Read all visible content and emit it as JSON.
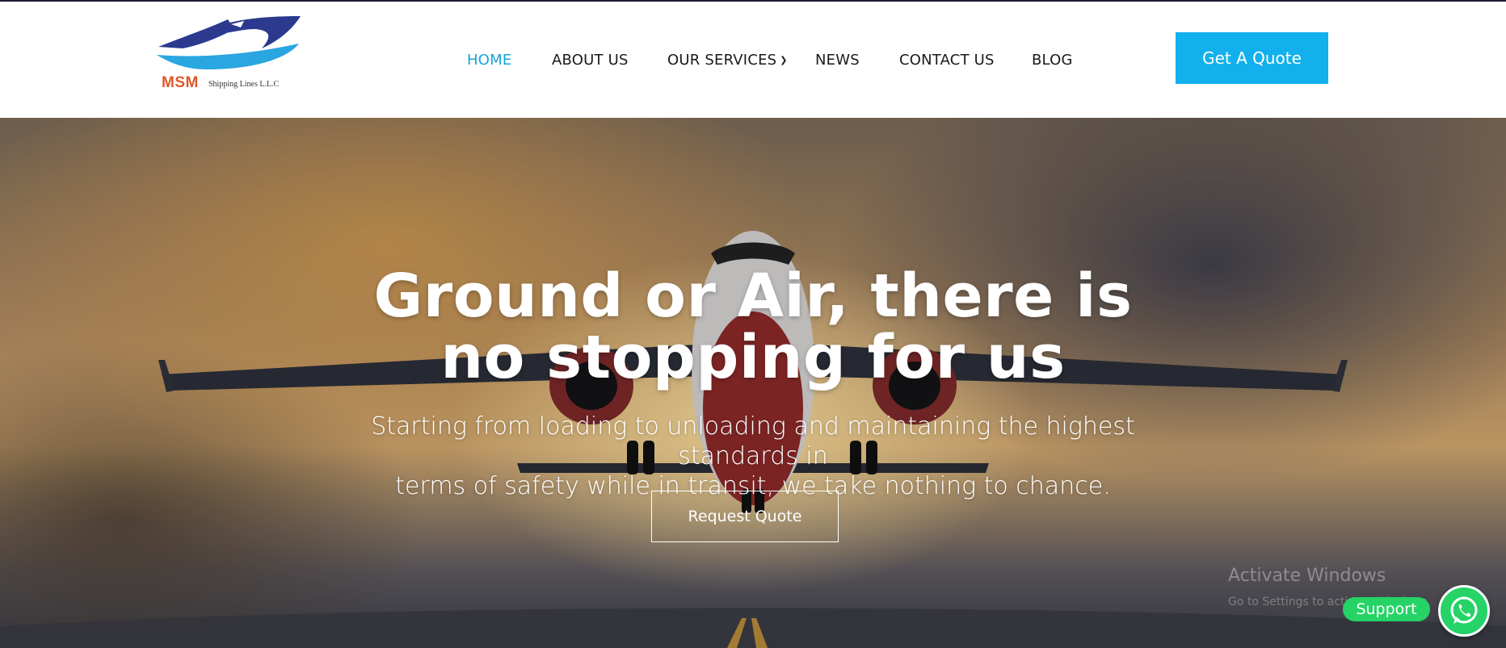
{
  "brand": {
    "name": "MSM",
    "tagline": "Shipping Lines L.L.C",
    "colors": {
      "navy": "#2b3a8f",
      "sky": "#2aa6e0",
      "orange": "#e0562a"
    }
  },
  "nav": {
    "items": [
      {
        "label": "HOME",
        "active": true
      },
      {
        "label": "ABOUT US"
      },
      {
        "label": "OUR SERVICES",
        "has_dropdown": true
      },
      {
        "label": "NEWS"
      },
      {
        "label": "CONTACT US"
      },
      {
        "label": "BLOG"
      }
    ],
    "active_color": "#13a6d8",
    "cta_label": "Get A Quote",
    "cta_color": "#12b0ec"
  },
  "hero": {
    "title_line1": "Ground or Air, there is",
    "title_line2": "no stopping for us",
    "subtitle_line1": "Starting from loading to unloading and maintaining the highest standards in",
    "subtitle_line2": "terms of safety while in transit, we take nothing to chance.",
    "button_label": "Request Quote"
  },
  "watermark": {
    "line1": "Activate Windows",
    "line2": "Go to Settings to activate Windows."
  },
  "support": {
    "label": "Support",
    "color": "#25d366",
    "icon": "whatsapp-icon"
  }
}
